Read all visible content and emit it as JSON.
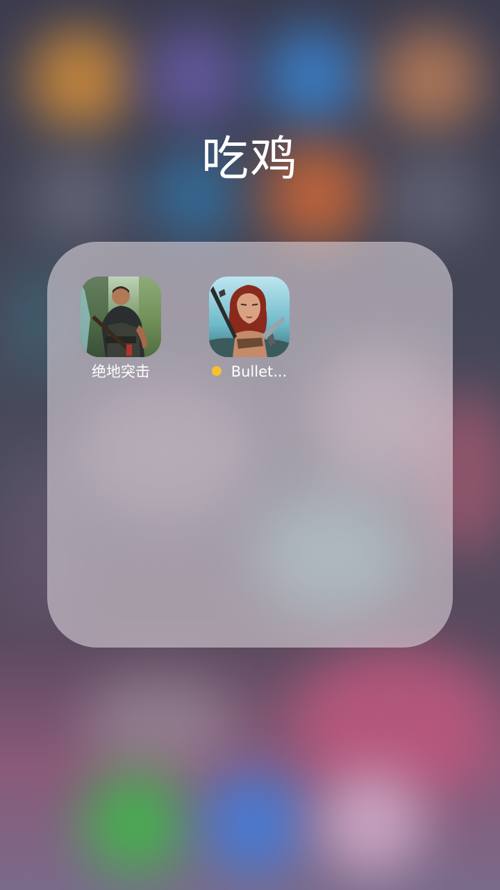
{
  "folder": {
    "title": "吃鸡"
  },
  "apps": [
    {
      "label": "绝地突击",
      "icon": "soldier-back-game-icon",
      "has_update_dot": false
    },
    {
      "label": "Bullet...",
      "icon": "redhead-gunwoman-game-icon",
      "has_update_dot": true
    }
  ],
  "colors": {
    "update_dot": "#f5c12e",
    "label_text": "#ffffff",
    "folder_panel": "#d6ced6"
  }
}
